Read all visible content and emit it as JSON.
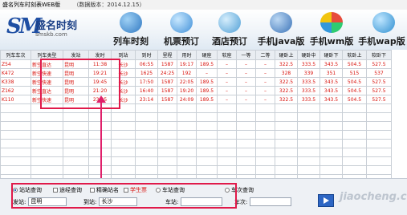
{
  "window": {
    "title": "盛名列车时刻表WEB版",
    "version_note": "（数据版本：2014.12.15）"
  },
  "brand": {
    "name": "盛名时刻",
    "site": "smskb.com",
    "logo_letters": "SM"
  },
  "nav": [
    {
      "label": "列车时刻",
      "icon": "train-icon",
      "color": "#3a86d0"
    },
    {
      "label": "机票预订",
      "icon": "airplane-icon",
      "color": "#4a9be0"
    },
    {
      "label": "酒店预订",
      "icon": "hotel-icon",
      "color": "#5aa7dd"
    },
    {
      "label": "手机java版",
      "icon": "phone-java-icon",
      "color": "#4b86c8"
    },
    {
      "label": "手机wm版",
      "icon": "windows-mobile-icon",
      "color": "#e7a52c"
    },
    {
      "label": "手机wap版",
      "icon": "phone-wap-icon",
      "color": "#3c9fd8"
    }
  ],
  "table": {
    "headers": [
      "列车车次",
      "列车类型",
      "发站",
      "发时",
      "到站",
      "到时",
      "里程",
      "用时",
      "硬座",
      "软座",
      "一等",
      "二等",
      "硬卧上",
      "硬卧中",
      "硬卧下",
      "软卧上",
      "软卧下"
    ],
    "rows": [
      [
        "Z54",
        "新空直达",
        "昆明",
        "11:38",
        "长沙",
        "06:55",
        "1587",
        "19:17",
        "189.5",
        "–",
        "–",
        "–",
        "322.5",
        "333.5",
        "343.5",
        "504.5",
        "527.5"
      ],
      [
        "K472",
        "新空快速",
        "昆明",
        "19:21",
        "长沙",
        "1625",
        "24:25",
        "192",
        "–",
        "–",
        "–",
        "–",
        "328",
        "339",
        "351",
        "515",
        "537"
      ],
      [
        "K338",
        "新空快速",
        "昆明",
        "19:45",
        "长沙",
        "17:50",
        "1587",
        "22:05",
        "189.5",
        "–",
        "–",
        "–",
        "322.5",
        "333.5",
        "343.5",
        "504.5",
        "527.5"
      ],
      [
        "Z162",
        "新空直达",
        "昆明",
        "21:20",
        "长沙",
        "16:40",
        "1587",
        "19:20",
        "189.5",
        "–",
        "–",
        "–",
        "322.5",
        "333.5",
        "343.5",
        "504.5",
        "527.5"
      ],
      [
        "K110",
        "新空快速",
        "昆明",
        "23:05",
        "长沙",
        "23:14",
        "1587",
        "24:09",
        "189.5",
        "–",
        "–",
        "–",
        "322.5",
        "333.5",
        "343.5",
        "504.5",
        "527.5"
      ]
    ]
  },
  "query": {
    "mode_station": "站站查询",
    "via_query": "途经查询",
    "exact_station": "精确站名",
    "student_ticket": "学生票",
    "station_query": "车站查询",
    "train_query": "车次查询",
    "from_label": "发站:",
    "from_value": "昆明",
    "to_label": "到站:",
    "to_value": "长沙",
    "station_label": "车站:",
    "station_value": "",
    "train_label": "车次:",
    "train_value": ""
  },
  "watermark": "jiaocheng.com",
  "colors": {
    "highlight": "#e01a4a",
    "row_text": "#d8120c",
    "arrow": "#e0206a"
  }
}
